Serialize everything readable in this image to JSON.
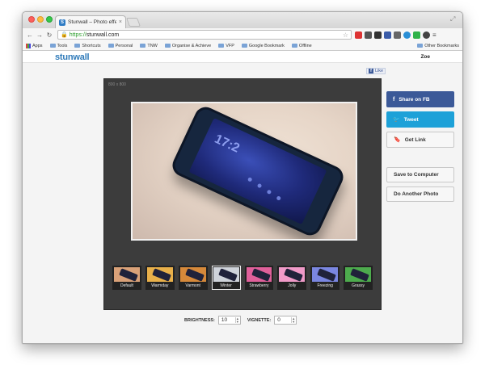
{
  "browser": {
    "tab_title": "Stunwall – Photo effects...",
    "favicon_letter": "S",
    "tab_close": "×",
    "url_scheme": "https://",
    "url_host": "stunwall.com"
  },
  "bookmarks": [
    {
      "label": "Apps",
      "type": "apps"
    },
    {
      "label": "Tools",
      "type": "folder"
    },
    {
      "label": "Shortcuts",
      "type": "folder"
    },
    {
      "label": "Personal",
      "type": "folder"
    },
    {
      "label": "TNW",
      "type": "folder"
    },
    {
      "label": "Organise & Achieve",
      "type": "folder"
    },
    {
      "label": "VFP",
      "type": "folder"
    },
    {
      "label": "Google Bookmark",
      "type": "folder"
    },
    {
      "label": "Offline",
      "type": "folder"
    }
  ],
  "other_bookmarks": "Other Bookmarks",
  "site": {
    "logo": "stunwall",
    "user": "Zoe",
    "fb_like": "Like",
    "dimensions": "800 x 800"
  },
  "filters": [
    {
      "label": "Default",
      "tint": "#d9a178"
    },
    {
      "label": "Warmday",
      "tint": "#e8b04a"
    },
    {
      "label": "Varmont",
      "tint": "#d6893a"
    },
    {
      "label": "Winter",
      "tint": "#cfd3da"
    },
    {
      "label": "Strawberry",
      "tint": "#e0609a"
    },
    {
      "label": "Jolly",
      "tint": "#f09ac8"
    },
    {
      "label": "Freezing",
      "tint": "#7a86e0"
    },
    {
      "label": "Grassy",
      "tint": "#4dab4d"
    }
  ],
  "selected_filter": "Winter",
  "controls": {
    "brightness_label": "BRIGHTNESS:",
    "brightness_value": "10",
    "vignette_label": "VIGNETTE:",
    "vignette_value": "0"
  },
  "sidebar": {
    "share_fb": "Share on FB",
    "tweet": "Tweet",
    "get_link": "Get Link",
    "save": "Save to Computer",
    "another": "Do Another Photo"
  },
  "photo": {
    "clock_text": "17:2"
  }
}
